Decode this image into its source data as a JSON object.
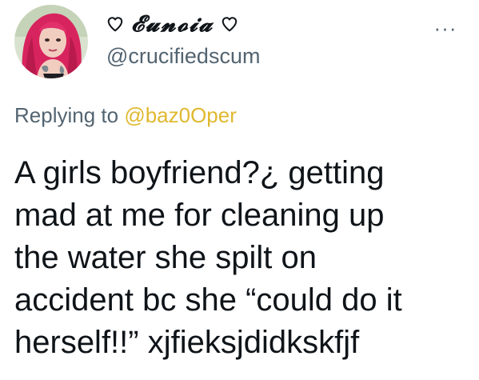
{
  "author": {
    "display_name": "𝓔𝓾𝓷𝓸𝓲𝓪",
    "handle": "@crucifiedscum",
    "avatar_icon": "profile-photo-pink-hair",
    "name_decoration_icon": "heart-outline-icon"
  },
  "menu": {
    "icon": "more-horizontal-icon",
    "glyph": "···"
  },
  "reply": {
    "prefix": "Replying to",
    "handle": "@baz0Oper"
  },
  "tweet": {
    "lines": [
      "A girls boyfriend?¿ getting",
      "mad at me for cleaning up",
      "the water she spilt on",
      "accident bc she “could do it",
      "herself!!” xjfieksjdidkskfjf"
    ]
  },
  "colors": {
    "text": "#0f1419",
    "secondary": "#536471",
    "mention": "#e0b82f",
    "hair": "#d8245e"
  }
}
